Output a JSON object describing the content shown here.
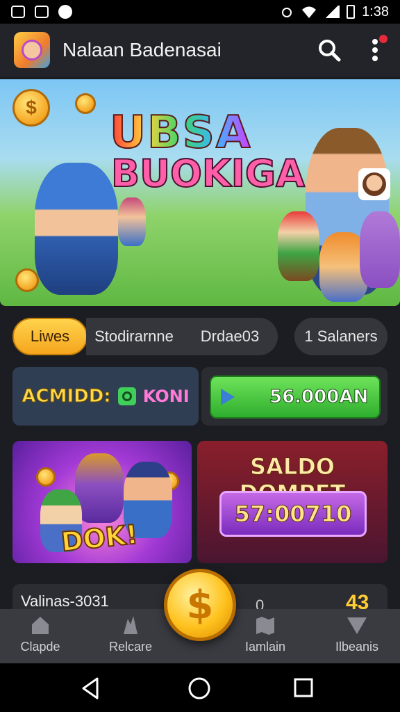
{
  "status_bar": {
    "time": "1:38"
  },
  "app_bar": {
    "title": "Nalaan Badenasai"
  },
  "hero": {
    "title_line1": "UBSA",
    "title_line2": "BUOKIGA"
  },
  "tabs": [
    {
      "label": "Liwes",
      "active": true
    },
    {
      "label": "Stodirarnne",
      "active": false
    },
    {
      "label": "Drdae03",
      "active": false
    },
    {
      "label": "1 Salaners",
      "active": false
    }
  ],
  "promo": {
    "label": "ACMIDD:",
    "code": "KONI"
  },
  "play": {
    "amount": "56.000AN"
  },
  "dok_card": {
    "text": "DOK!"
  },
  "saldo": {
    "title": "SALDO DOMPET",
    "value": "57:00710"
  },
  "partial_row": {
    "label": "Valinas-3031",
    "num1": "0",
    "num2": "43"
  },
  "bottom_nav": [
    {
      "label": "Clapde",
      "icon": "home-icon"
    },
    {
      "label": "Relcare",
      "icon": "trophy-icon"
    },
    {
      "label": "",
      "icon": "coin-icon"
    },
    {
      "label": "Iamlain",
      "icon": "map-icon"
    },
    {
      "label": "Ilbeanis",
      "icon": "shield-icon"
    }
  ],
  "colors": {
    "accent": "#f5a51d",
    "play": "#2fae2e",
    "background": "#1c1d22"
  }
}
